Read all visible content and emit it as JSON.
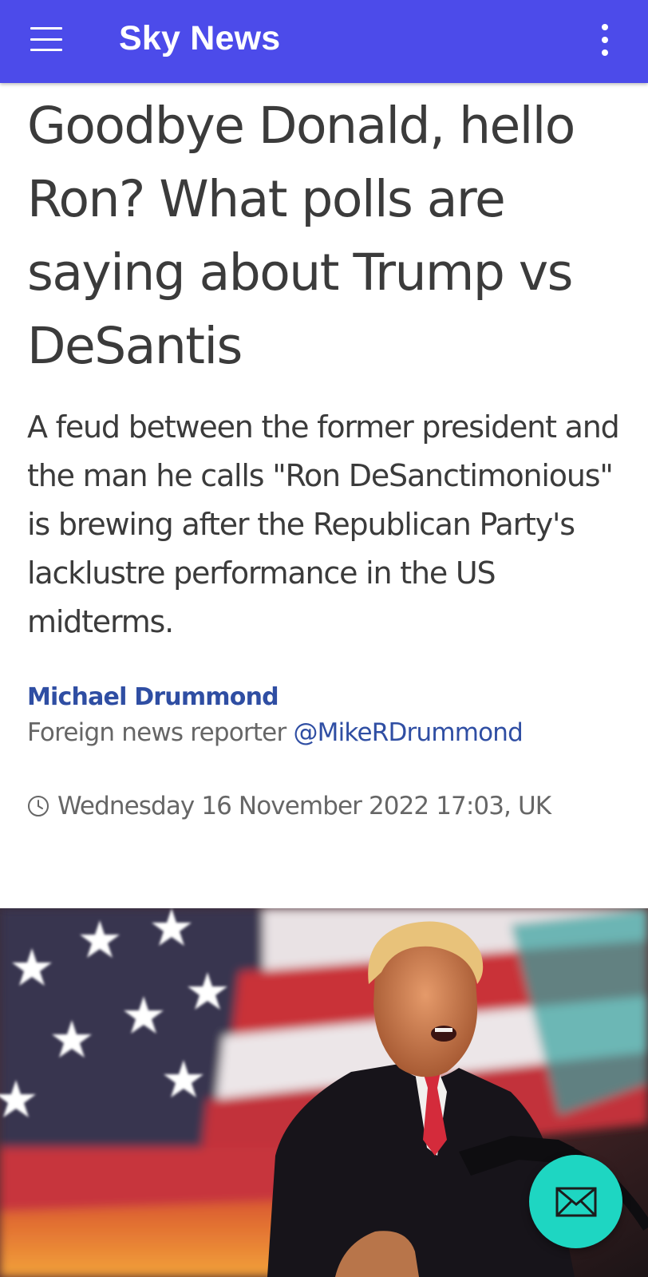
{
  "app_bar": {
    "title": "Sky News",
    "menu_icon": "hamburger-menu-icon",
    "overflow_icon": "more-vert-icon",
    "color": "#4c4bea"
  },
  "article": {
    "headline": "Goodbye Donald, hello Ron? What polls are saying about Trump vs DeSantis",
    "standfirst": "A feud between the former president and the man he calls \"Ron DeSanctimonious\" is brewing after the Republican Party's lacklustre performance in the US midterms.",
    "author": {
      "name": "Michael Drummond",
      "role": "Foreign news reporter",
      "handle": "@MikeRDrummond"
    },
    "timestamp": "Wednesday 16 November 2022 17:03, UK",
    "timestamp_icon": "clock-icon",
    "link_color": "#2f4ea3"
  },
  "fab": {
    "icon": "mail-icon",
    "color": "#1ed6c2"
  }
}
